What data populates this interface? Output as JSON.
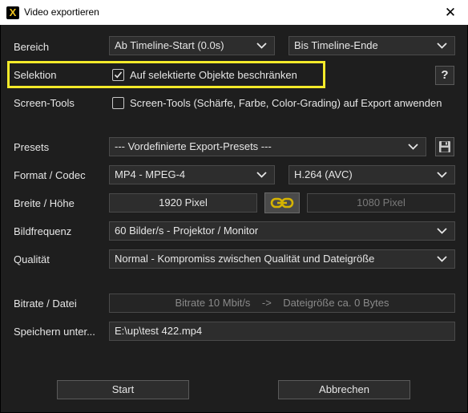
{
  "window": {
    "title": "Video exportieren",
    "close_glyph": "✕",
    "app_icon_glyph": "X"
  },
  "rows": {
    "bereich": {
      "label": "Bereich",
      "start": "Ab Timeline-Start (0.0s)",
      "end": "Bis Timeline-Ende"
    },
    "selektion": {
      "label": "Selektion",
      "checkbox_label": "Auf selektierte Objekte beschränken",
      "checked": true,
      "help": "?"
    },
    "screen_tools": {
      "label": "Screen-Tools",
      "checkbox_label": "Screen-Tools (Schärfe, Farbe, Color-Grading) auf Export anwenden",
      "checked": false
    },
    "presets": {
      "label": "Presets",
      "value": "--- Vordefinierte Export-Presets ---"
    },
    "format": {
      "label": "Format / Codec",
      "format": "MP4 - MPEG-4",
      "codec": "H.264 (AVC)"
    },
    "size": {
      "label": "Breite / Höhe",
      "width": "1920 Pixel",
      "height": "1080 Pixel"
    },
    "framerate": {
      "label": "Bildfrequenz",
      "value": "60 Bilder/s - Projektor / Monitor"
    },
    "quality": {
      "label": "Qualität",
      "value": "Normal - Kompromiss zwischen Qualität und Dateigröße"
    },
    "bitrate": {
      "label": "Bitrate / Datei",
      "value": "Bitrate 10 Mbit/s    ->    Dateigröße ca. 0 Bytes"
    },
    "save": {
      "label": "Speichern unter...",
      "value": "E:\\up\\test 422.mp4"
    }
  },
  "buttons": {
    "start": "Start",
    "cancel": "Abbrechen"
  },
  "icons": {
    "help": "help-icon",
    "save": "floppy-disk-icon",
    "link": "chain-link-icon",
    "chevron": "chevron-down-icon",
    "check": "check-icon"
  },
  "colors": {
    "highlight": "#f4ea2a",
    "link_button": "#d6b400",
    "background": "#1e1e1e"
  }
}
